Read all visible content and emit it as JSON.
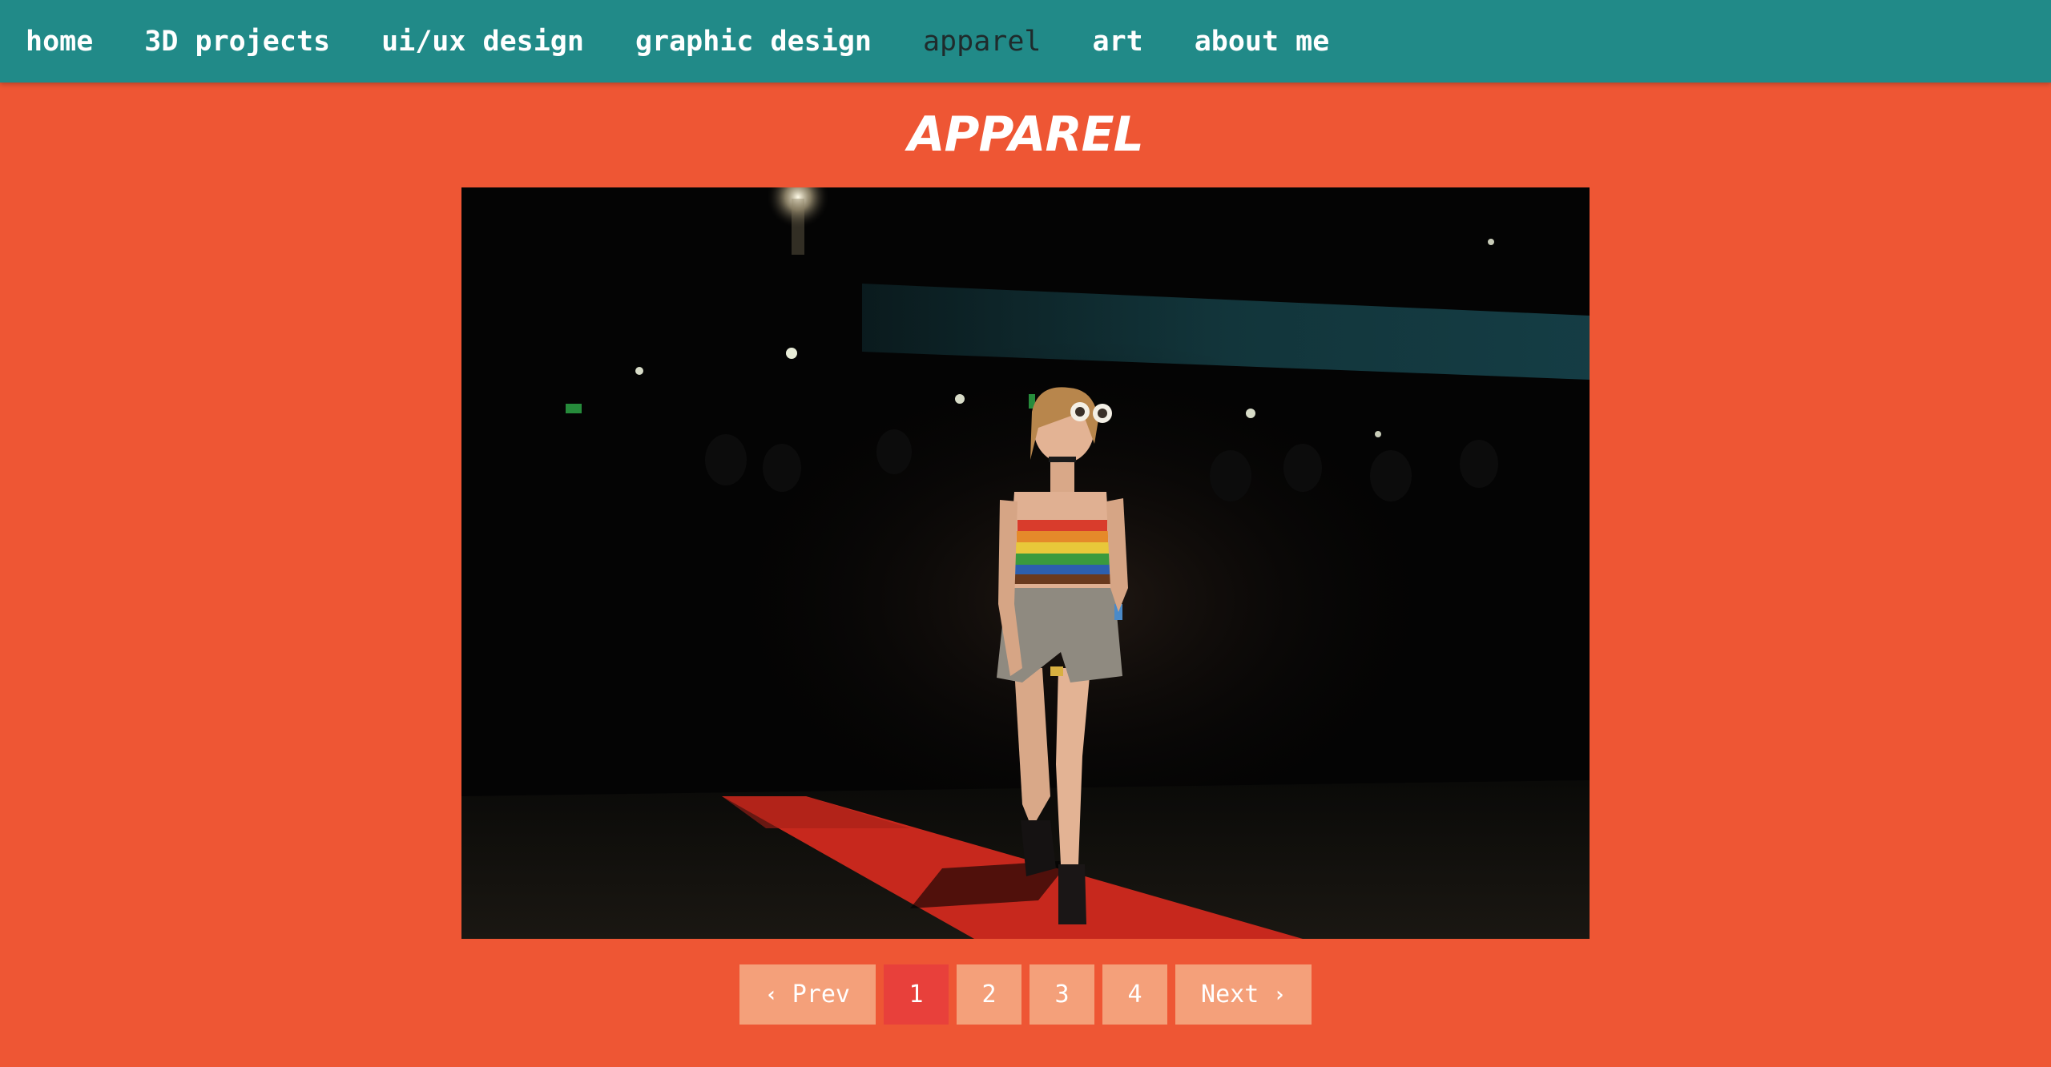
{
  "nav": {
    "items": [
      {
        "label": "home"
      },
      {
        "label": "3D projects"
      },
      {
        "label": "ui/ux design"
      },
      {
        "label": "graphic design"
      },
      {
        "label": "apparel",
        "active": true
      },
      {
        "label": "art"
      },
      {
        "label": "about me"
      }
    ]
  },
  "page": {
    "title": "APPAREL"
  },
  "pagination": {
    "prev_label": "Prev",
    "next_label": "Next",
    "prev_icon": "‹",
    "next_icon": "›",
    "pages": [
      "1",
      "2",
      "3",
      "4"
    ],
    "current_page": "1"
  },
  "colors": {
    "nav_background": "#218a88",
    "page_background": "#ee5634",
    "pager_button": "#f4a07a",
    "pager_current": "#e8403b",
    "nav_active_text": "#1f2b2c"
  }
}
